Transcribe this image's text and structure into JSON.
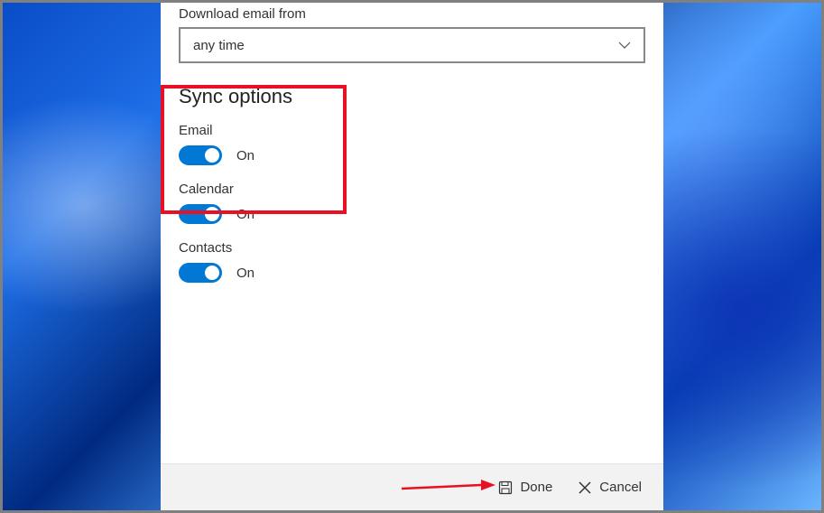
{
  "downloadSection": {
    "label": "Download email from",
    "selectedValue": "any time"
  },
  "syncOptions": {
    "title": "Sync options",
    "items": [
      {
        "label": "Email",
        "state": "On",
        "enabled": true
      },
      {
        "label": "Calendar",
        "state": "On",
        "enabled": true
      },
      {
        "label": "Contacts",
        "state": "On",
        "enabled": true
      }
    ]
  },
  "footer": {
    "doneLabel": "Done",
    "cancelLabel": "Cancel"
  },
  "colors": {
    "accent": "#0078d4",
    "highlight": "#e81123"
  }
}
